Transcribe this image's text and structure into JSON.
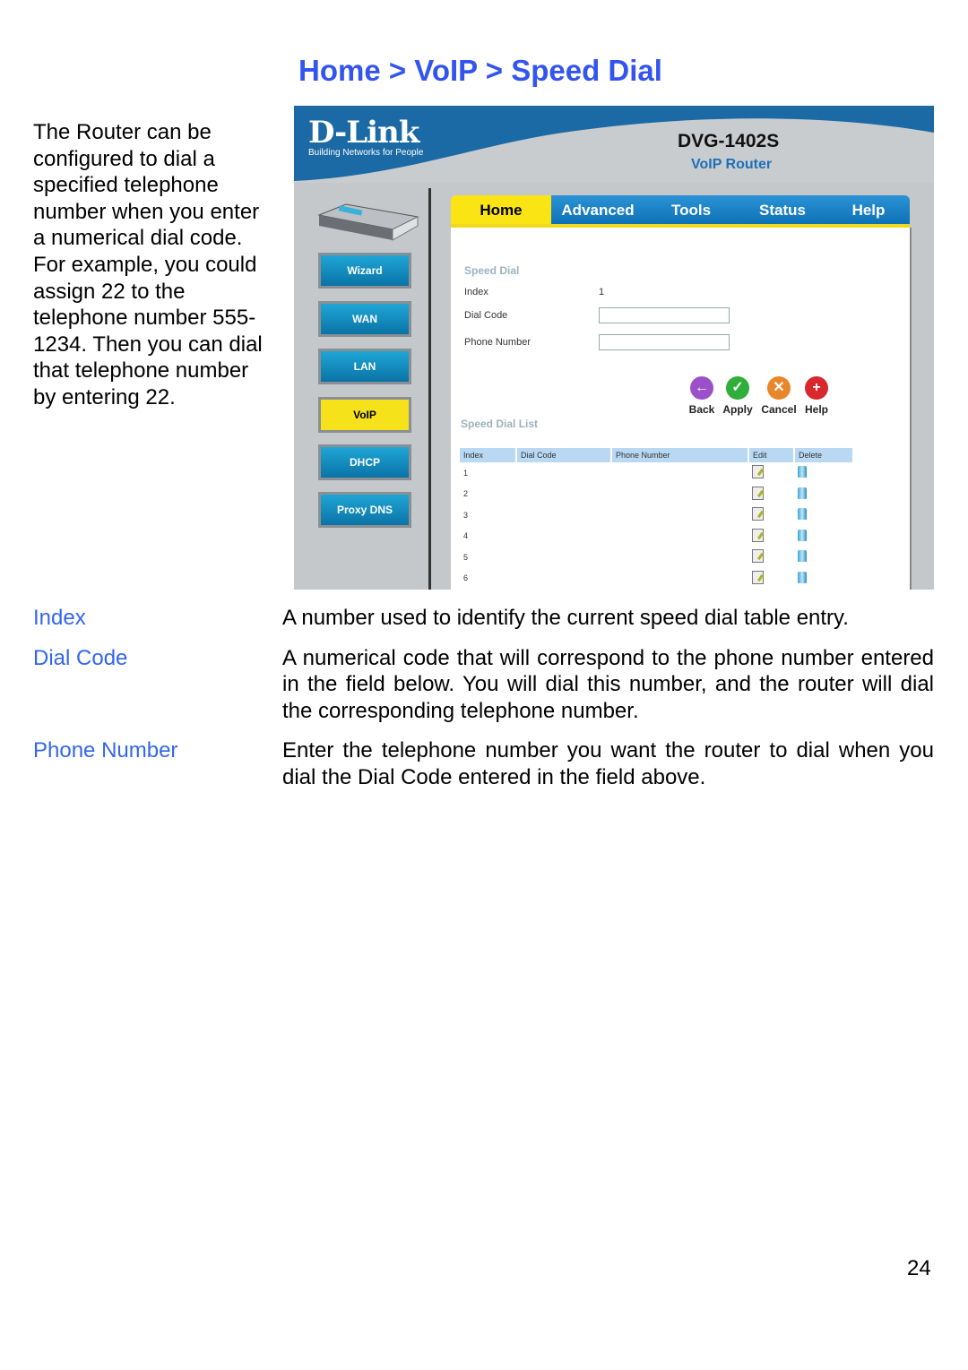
{
  "page": {
    "breadcrumb": "Home > VoIP > Speed Dial",
    "intro": "The Router can be configured to dial a specified telephone number when you enter a numerical dial code.  For example, you could assign 22 to the telephone number 555-1234.  Then you can dial that telephone number by entering 22.",
    "page_number": "24"
  },
  "router_ui": {
    "brand": "D-Link",
    "tagline": "Building Networks for People",
    "model": "DVG-1402S",
    "model_subtitle": "VoIP Router",
    "tabs": [
      {
        "label": "Home",
        "active": true
      },
      {
        "label": "Advanced",
        "active": false
      },
      {
        "label": "Tools",
        "active": false
      },
      {
        "label": "Status",
        "active": false
      },
      {
        "label": "Help",
        "active": false
      }
    ],
    "sidebar": [
      {
        "label": "Wizard",
        "active": false
      },
      {
        "label": "WAN",
        "active": false
      },
      {
        "label": "LAN",
        "active": false
      },
      {
        "label": "VoIP",
        "active": true
      },
      {
        "label": "DHCP",
        "active": false
      },
      {
        "label": "Proxy DNS",
        "active": false
      }
    ],
    "form": {
      "section_title": "Speed Dial",
      "index_label": "Index",
      "index_value": "1",
      "dial_code_label": "Dial Code",
      "dial_code_value": "",
      "phone_number_label": "Phone Number",
      "phone_number_value": ""
    },
    "actions": [
      {
        "label": "Back",
        "icon": "back-arrow-icon",
        "color": "#9b4fc9"
      },
      {
        "label": "Apply",
        "icon": "checkmark-icon",
        "color": "#2fae3a"
      },
      {
        "label": "Cancel",
        "icon": "x-icon",
        "color": "#e8862a"
      },
      {
        "label": "Help",
        "icon": "plus-icon",
        "color": "#d8282e"
      }
    ],
    "list": {
      "title": "Speed Dial List",
      "columns": [
        "Index",
        "Dial Code",
        "Phone Number",
        "Edit",
        "Delete"
      ],
      "rows": [
        {
          "index": "1",
          "dial_code": "",
          "phone_number": ""
        },
        {
          "index": "2",
          "dial_code": "",
          "phone_number": ""
        },
        {
          "index": "3",
          "dial_code": "",
          "phone_number": ""
        },
        {
          "index": "4",
          "dial_code": "",
          "phone_number": ""
        },
        {
          "index": "5",
          "dial_code": "",
          "phone_number": ""
        },
        {
          "index": "6",
          "dial_code": "",
          "phone_number": ""
        }
      ]
    }
  },
  "definitions": [
    {
      "term": "Index",
      "description": "A number used to identify the current speed dial table entry."
    },
    {
      "term": "Dial Code",
      "description": "A numerical code that will correspond to the phone number entered in the field below. You will dial this number, and the router will dial the corresponding telephone number."
    },
    {
      "term": "Phone Number",
      "description": "Enter the telephone number you want the router to dial when you dial the Dial Code entered in the field above."
    }
  ]
}
